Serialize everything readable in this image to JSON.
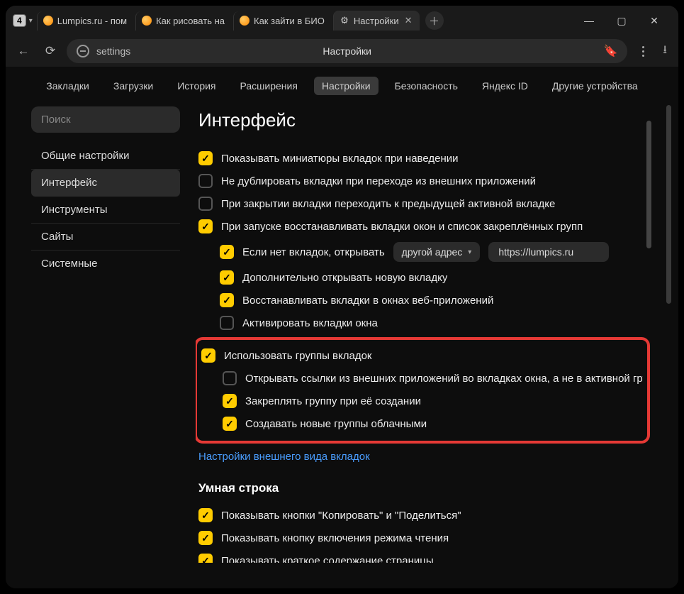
{
  "titlebar": {
    "tab_count": "4",
    "tabs": [
      {
        "label": "Lumpics.ru - пом",
        "icon": "orange"
      },
      {
        "label": "Как рисовать на",
        "icon": "orange"
      },
      {
        "label": "Как зайти в БИО",
        "icon": "orange"
      },
      {
        "label": "Настройки",
        "icon": "gear",
        "active": true,
        "closeable": true
      }
    ]
  },
  "navbar": {
    "url": "settings",
    "page_title": "Настройки"
  },
  "topnav": {
    "items": [
      {
        "label": "Закладки"
      },
      {
        "label": "Загрузки"
      },
      {
        "label": "История"
      },
      {
        "label": "Расширения"
      },
      {
        "label": "Настройки",
        "active": true
      },
      {
        "label": "Безопасность"
      },
      {
        "label": "Яндекс ID"
      },
      {
        "label": "Другие устройства"
      }
    ]
  },
  "sidebar": {
    "search_placeholder": "Поиск",
    "items": [
      {
        "label": "Общие настройки"
      },
      {
        "label": "Интерфейс",
        "active": true
      },
      {
        "label": "Инструменты"
      },
      {
        "label": "Сайты"
      },
      {
        "label": "Системные"
      }
    ]
  },
  "main": {
    "section_title": "Интерфейс",
    "rows": [
      {
        "checked": true,
        "label": "Показывать миниатюры вкладок при наведении"
      },
      {
        "checked": false,
        "label": "Не дублировать вкладки при переходе из внешних приложений"
      },
      {
        "checked": false,
        "label": "При закрытии вкладки переходить к предыдущей активной вкладке"
      },
      {
        "checked": true,
        "label": "При запуске восстанавливать вкладки окон и список закреплённых групп"
      }
    ],
    "startup_sub": {
      "r0": {
        "checked": true,
        "label": "Если нет вкладок, открывать",
        "dropdown": "другой адрес",
        "url": "https://lumpics.ru"
      },
      "r1": {
        "checked": true,
        "label": "Дополнительно открывать новую вкладку"
      },
      "r2": {
        "checked": true,
        "label": "Восстанавливать вкладки в окнах веб-приложений"
      },
      "r3": {
        "checked": false,
        "label": "Активировать вкладки окна"
      }
    },
    "highlighted": {
      "r0": {
        "checked": true,
        "label": "Использовать группы вкладок"
      },
      "r1": {
        "checked": false,
        "label": "Открывать ссылки из внешних приложений во вкладках окна, а не в активной гру"
      },
      "r2": {
        "checked": true,
        "label": "Закреплять группу при её создании"
      },
      "r3": {
        "checked": true,
        "label": "Создавать новые группы облачными"
      }
    },
    "link": "Настройки внешнего вида вкладок",
    "subsection": "Умная строка",
    "smart_rows": [
      {
        "checked": true,
        "label": "Показывать кнопки \"Копировать\" и \"Поделиться\""
      },
      {
        "checked": true,
        "label": "Показывать кнопку включения режима чтения"
      },
      {
        "checked": true,
        "label": "Показывать краткое содержание страницы"
      }
    ]
  }
}
